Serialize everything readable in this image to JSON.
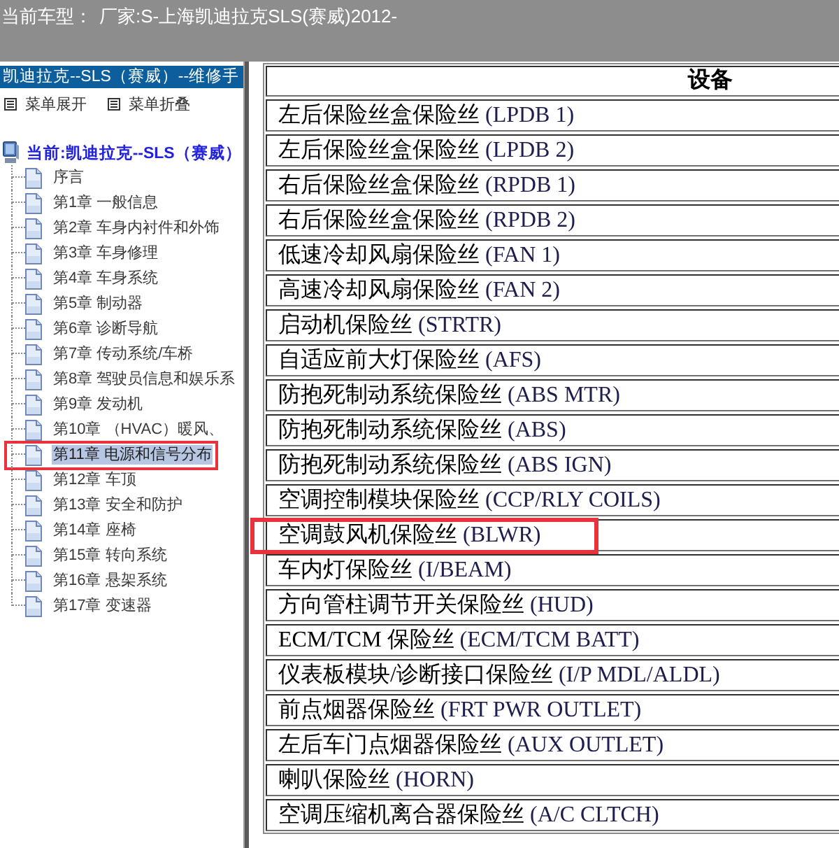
{
  "header": {
    "label": "当前车型：",
    "value": "厂家:S-上海凯迪拉克SLS(赛威)2012-"
  },
  "sidebar": {
    "title": "凯迪拉克--SLS（赛威）--维修手",
    "menu_actions": [
      "菜单展开",
      "菜单折叠"
    ],
    "tree": {
      "label": "当前:凯迪拉克--SLS（赛威）",
      "children": [
        {
          "label": "序言",
          "selected": false,
          "annotated": false
        },
        {
          "label": "第1章 一般信息",
          "selected": false,
          "annotated": false
        },
        {
          "label": "第2章 车身内衬件和外饰",
          "selected": false,
          "annotated": false
        },
        {
          "label": "第3章 车身修理",
          "selected": false,
          "annotated": false
        },
        {
          "label": "第4章 车身系统",
          "selected": false,
          "annotated": false
        },
        {
          "label": "第5章 制动器",
          "selected": false,
          "annotated": false
        },
        {
          "label": "第6章 诊断导航",
          "selected": false,
          "annotated": false
        },
        {
          "label": "第7章 传动系统/车桥",
          "selected": false,
          "annotated": false
        },
        {
          "label": "第8章 驾驶员信息和娱乐系",
          "selected": false,
          "annotated": false
        },
        {
          "label": "第9章 发动机",
          "selected": false,
          "annotated": false
        },
        {
          "label": "第10章 （HVAC）暖风、",
          "selected": false,
          "annotated": false
        },
        {
          "label": "第11章 电源和信号分布",
          "selected": true,
          "annotated": true
        },
        {
          "label": "第12章 车顶",
          "selected": false,
          "annotated": false
        },
        {
          "label": "第13章 安全和防护",
          "selected": false,
          "annotated": false
        },
        {
          "label": "第14章 座椅",
          "selected": false,
          "annotated": false
        },
        {
          "label": "第15章 转向系统",
          "selected": false,
          "annotated": false
        },
        {
          "label": "第16章 悬架系统",
          "selected": false,
          "annotated": false
        },
        {
          "label": "第17章 变速器",
          "selected": false,
          "annotated": false
        }
      ]
    }
  },
  "table": {
    "columns": [
      "设备"
    ],
    "rows": [
      {
        "name": "左后保险丝盒保险丝",
        "code": "(LPDB 1)",
        "annotated": false
      },
      {
        "name": "左后保险丝盒保险丝",
        "code": "(LPDB 2)",
        "annotated": false
      },
      {
        "name": "右后保险丝盒保险丝",
        "code": "(RPDB 1)",
        "annotated": false
      },
      {
        "name": "右后保险丝盒保险丝",
        "code": "(RPDB 2)",
        "annotated": false
      },
      {
        "name": "低速冷却风扇保险丝",
        "code": "(FAN 1)",
        "annotated": false
      },
      {
        "name": "高速冷却风扇保险丝",
        "code": "(FAN 2)",
        "annotated": false
      },
      {
        "name": "启动机保险丝",
        "code": "(STRTR)",
        "annotated": false
      },
      {
        "name": "自适应前大灯保险丝",
        "code": "(AFS)",
        "annotated": false
      },
      {
        "name": "防抱死制动系统保险丝",
        "code": "(ABS MTR)",
        "annotated": false
      },
      {
        "name": "防抱死制动系统保险丝",
        "code": "(ABS)",
        "annotated": false
      },
      {
        "name": "防抱死制动系统保险丝",
        "code": "(ABS IGN)",
        "annotated": false
      },
      {
        "name": "空调控制模块保险丝",
        "code": "(CCP/RLY COILS)",
        "annotated": false
      },
      {
        "name": "空调鼓风机保险丝",
        "code": "(BLWR)",
        "annotated": true
      },
      {
        "name": "车内灯保险丝",
        "code": "(I/BEAM)",
        "annotated": false
      },
      {
        "name": "方向管柱调节开关保险丝",
        "code": "(HUD)",
        "annotated": false
      },
      {
        "name": "ECM/TCM 保险丝",
        "code": "(ECM/TCM BATT)",
        "annotated": false
      },
      {
        "name": "仪表板模块/诊断接口保险丝",
        "code": "(I/P MDL/ALDL)",
        "annotated": false
      },
      {
        "name": "前点烟器保险丝",
        "code": "(FRT PWR OUTLET)",
        "annotated": false
      },
      {
        "name": "左后车门点烟器保险丝",
        "code": "(AUX OUTLET)",
        "annotated": false
      },
      {
        "name": "喇叭保险丝",
        "code": "(HORN)",
        "annotated": false
      },
      {
        "name": "空调压缩机离合器保险丝",
        "code": "(A/C CLTCH)",
        "annotated": false
      }
    ]
  }
}
